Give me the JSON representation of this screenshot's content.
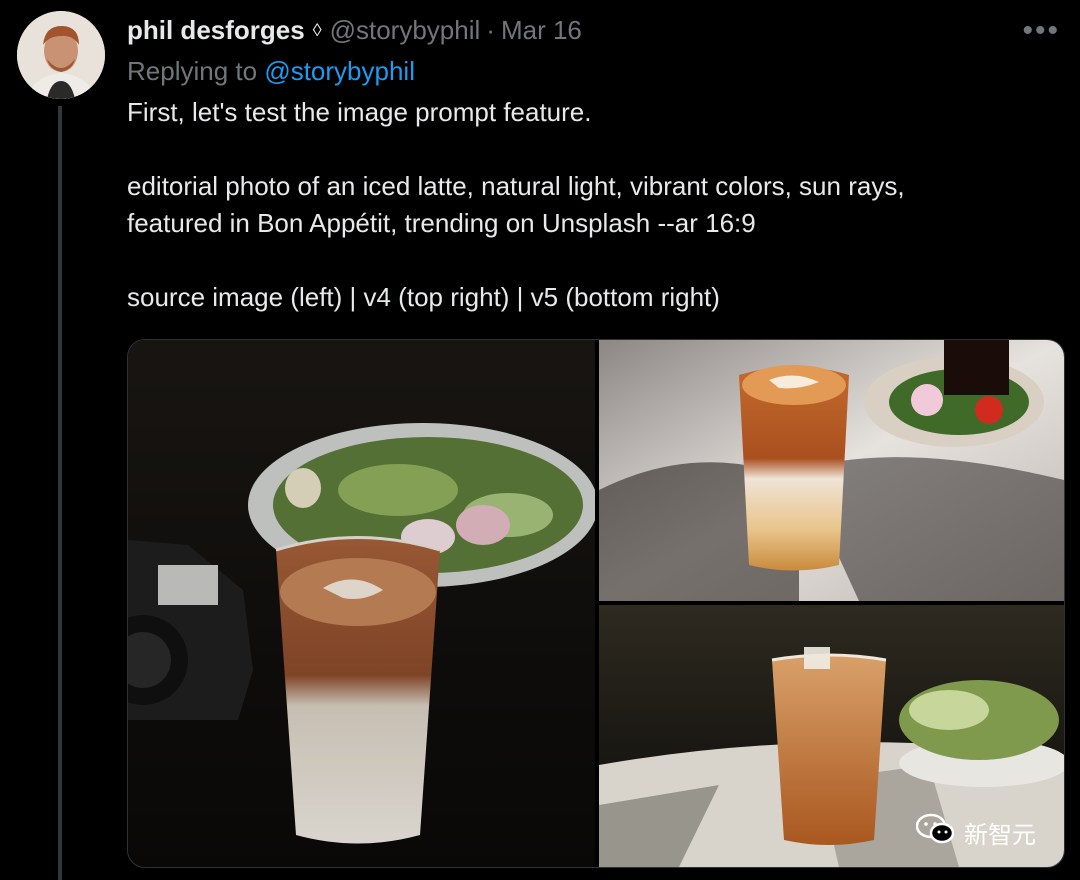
{
  "author": {
    "name": "phil desforges",
    "verified_icon": "◊",
    "handle": "@storybyphil",
    "separator": "·",
    "date": "Mar 16"
  },
  "more_icon": "•••",
  "reply": {
    "prefix": "Replying to",
    "mention": "@storybyphil"
  },
  "tweet": {
    "line1": "First, let's test the image prompt feature.",
    "line2": "editorial photo of an iced latte, natural light, vibrant colors, sun rays,",
    "line3": "featured in Bon Appétit, trending on Unsplash --ar 16:9",
    "line4": "source image (left) | v4 (top right) | v5 (bottom right)"
  },
  "watermark": {
    "icon": "wechat-icon",
    "text": "新智元"
  },
  "colors": {
    "background": "#000000",
    "text": "#e7e9ea",
    "muted": "#71767b",
    "link": "#1d9bf0"
  }
}
